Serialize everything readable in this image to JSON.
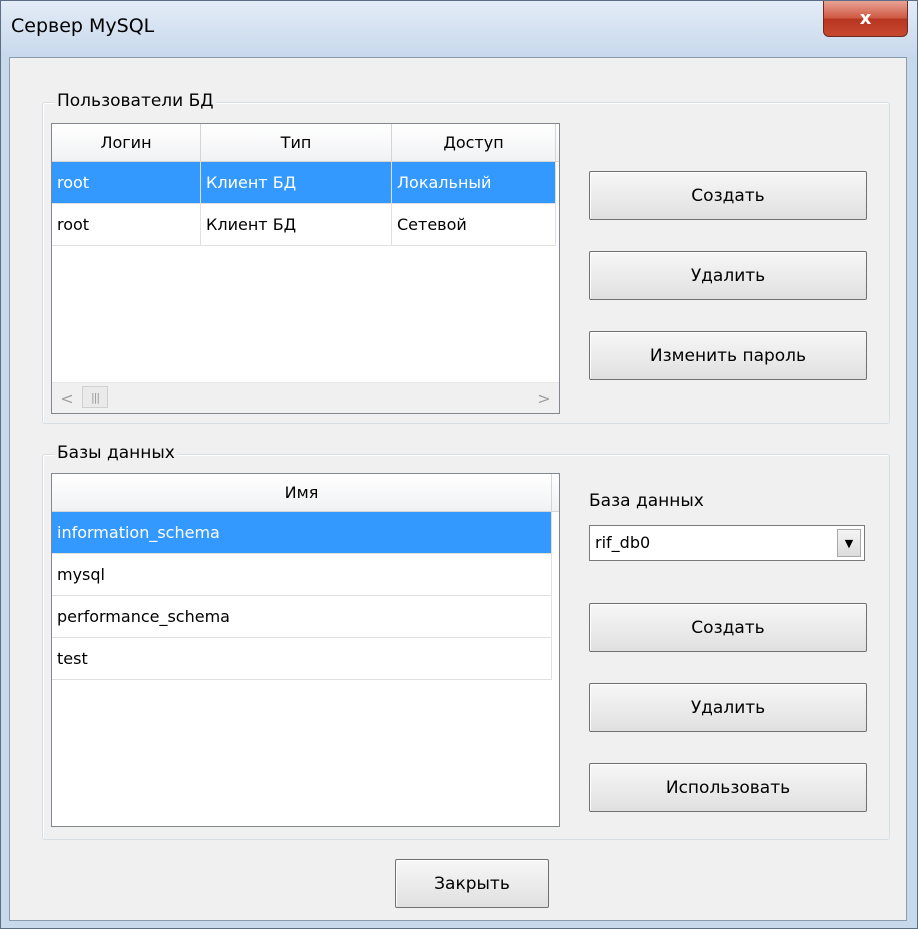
{
  "window": {
    "title": "Сервер MySQL",
    "close_glyph": "x",
    "close_icon": "close-icon"
  },
  "users_group": {
    "label": "Пользователи БД",
    "columns": [
      "Логин",
      "Тип",
      "Доступ"
    ],
    "rows": [
      {
        "login": "root",
        "type": "Клиент БД",
        "access": "Локальный",
        "selected": true
      },
      {
        "login": "root",
        "type": "Клиент БД",
        "access": "Сетевой",
        "selected": false
      }
    ],
    "scroll_left_icon": "chevron-left-icon",
    "scroll_right_icon": "chevron-right-icon",
    "scroll_thumb_grip": "|||",
    "scroll_left_glyph": "<",
    "scroll_right_glyph": ">",
    "create_label": "Создать",
    "delete_label": "Удалить",
    "change_password_label": "Изменить пароль"
  },
  "db_group": {
    "label": "Базы данных",
    "columns": [
      "Имя"
    ],
    "rows": [
      {
        "name": "information_schema",
        "selected": true
      },
      {
        "name": "mysql",
        "selected": false
      },
      {
        "name": "performance_schema",
        "selected": false
      },
      {
        "name": "test",
        "selected": false
      }
    ],
    "db_select_label": "База данных",
    "db_select_value": "rif_db0",
    "db_select_arrow": "▼",
    "create_label": "Создать",
    "delete_label": "Удалить",
    "use_label": "Использовать"
  },
  "footer": {
    "close_label": "Закрыть"
  },
  "colors": {
    "selection": "#3399ff",
    "close_button": "#c9472f"
  }
}
